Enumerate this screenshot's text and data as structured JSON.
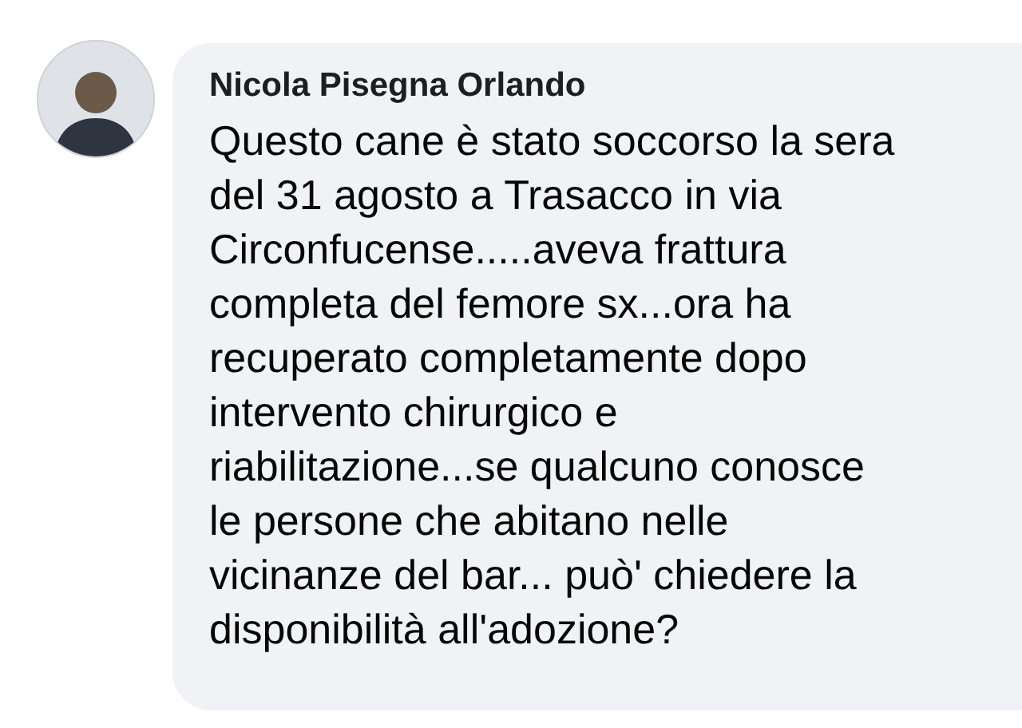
{
  "comment": {
    "author": "Nicola Pisegna Orlando",
    "text_lines": [
      "Questo cane è stato soccorso la sera",
      "del 31 agosto a Trasacco in via",
      "Circonfucense.....aveva frattura",
      "completa del femore sx...ora ha",
      "recuperato completamente dopo",
      "intervento chirurgico e",
      "riabilitazione...se qualcuno conosce",
      "le persone che abitano nelle",
      "vicinanze del bar... può' chiedere la",
      "disponibilità all'adozione?"
    ]
  }
}
